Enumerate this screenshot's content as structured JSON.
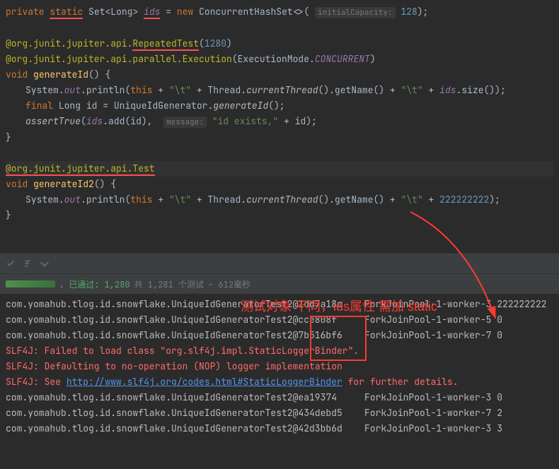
{
  "code": {
    "l1": {
      "private": "private",
      "static": "static",
      "set": "Set",
      "long": "Long",
      "ids": "ids",
      "new": "new",
      "chs": "ConcurrentHashSet",
      "hint": "initialCapacity:",
      "cap": "128"
    },
    "l3_pkg": "@org.junit.jupiter.api.",
    "l3_rt": "RepeatedTest",
    "l3_num": "1280",
    "l4_pkg": "@org.junit.jupiter.api.parallel.",
    "l4_exec": "Execution",
    "l4_mode": "ExecutionMode",
    "l4_conc": "CONCURRENT",
    "l5_void": "void",
    "l5_name": "generateId",
    "l6_sys": "System",
    "l6_out": "out",
    "l6_println": "println",
    "l6_this": "this",
    "l6_tab": "\"\\t\"",
    "l6_thread": "Thread",
    "l6_ct": "currentThread",
    "l6_gn": "getName",
    "l6_ids": "ids",
    "l6_size": "size",
    "l7_final": "final",
    "l7_long": "Long",
    "l7_id": "id",
    "l7_gen": "UniqueIdGenerator",
    "l7_gid": "generateId",
    "l8_at": "assertTrue",
    "l8_ids": "ids",
    "l8_add": "add",
    "l8_id": "id",
    "l8_hint": "message:",
    "l8_msg": "\"id exists,\"",
    "l8_id2": "id",
    "l11_pkg": "@org.junit.jupiter.api.",
    "l11_test": "Test",
    "l12_void": "void",
    "l12_name": "generateId2",
    "l13_sys": "System",
    "l13_out": "out",
    "l13_println": "println",
    "l13_this": "this",
    "l13_tab": "\"\\t\"",
    "l13_thread": "Thread",
    "l13_ct": "currentThread",
    "l13_gn": "getName",
    "l13_num": "222222222"
  },
  "status": {
    "passed": "已通过: 1,280",
    "total": "共 1,281 个测试",
    "time": "– 612毫秒"
  },
  "annot": {
    "text": "测试对象 不同，ids属性 需加 static"
  },
  "console": {
    "r1_cls": "com.yomahub.tlog.id.snowflake.UniqueIdGeneratorTest2",
    "r1_hash": "@1dd7a18c",
    "r1_th": "ForkJoinPool-1-worker-3",
    "r1_val": "222222222",
    "r2_hash": "@cce808f",
    "r2_th": "ForkJoinPool-1-worker-5",
    "r2_val": "0",
    "r3_hash": "@7b516bf6",
    "r3_th": "ForkJoinPool-1-worker-7",
    "r3_val": "0",
    "e1": "SLF4J: Failed to load class \"org.slf4j.impl.StaticLoggerBinder\".",
    "e2": "SLF4J: Defaulting to no-operation (NOP) logger implementation",
    "e3a": "SLF4J: See ",
    "e3link": "http://www.slf4j.org/codes.html#StaticLoggerBinder",
    "e3b": " for further details.",
    "r4_hash": "@ea19374",
    "r4_th": "ForkJoinPool-1-worker-3",
    "r4_val": "0",
    "r5_hash": "@434debd5",
    "r5_th": "ForkJoinPool-1-worker-7",
    "r5_val": "2",
    "r6_hash": "@42d3bb6d",
    "r6_th": "ForkJoinPool-1-worker-3",
    "r6_val": "3"
  }
}
